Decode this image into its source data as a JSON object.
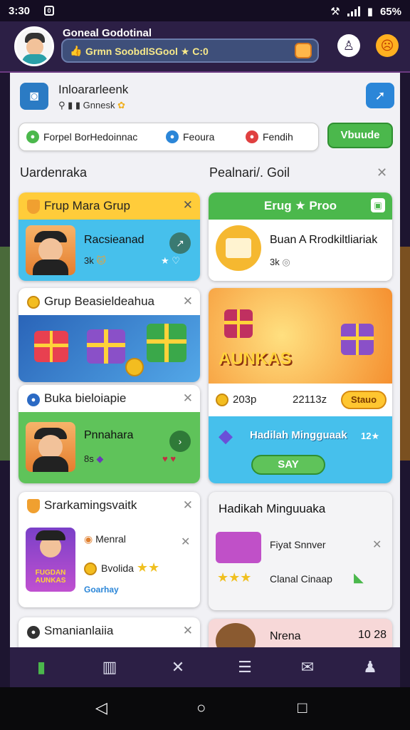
{
  "status_bar": {
    "time": "3:30",
    "notif": "0",
    "battery": "65%"
  },
  "header": {
    "title": "Goneal Godotinal",
    "search_value": "Grmn SoobdlSGool ★ C:0",
    "search_lead_icon": "thumbs-up-icon",
    "search_trail_icon": "gift-icon",
    "right_icons": [
      "user-badge-icon",
      "emoji-icon"
    ]
  },
  "profile": {
    "name": "Inloararleenk",
    "sub": "Gnnesk",
    "share_icon": "share-icon"
  },
  "filters": {
    "items": [
      "Forpel BorHedoinnac",
      "Feoura",
      "Fendih"
    ],
    "button": "Vbuude"
  },
  "sections": {
    "left": "Uardenraka",
    "right": "Pealnari/. Goil"
  },
  "cards": {
    "frup": {
      "title": "Frup Mara Grup",
      "name": "Racsieanad",
      "stat": "3k"
    },
    "grup": {
      "title": "Grup Beasieldeahua"
    },
    "buka": {
      "title": "Buka bieloiapie",
      "name": "Pnnahara",
      "stat": "8s"
    },
    "srark": {
      "title": "Srarkamingsvaitk",
      "item1": "Menral",
      "item2": "Bvolida",
      "game_title": "FUGDAN AUNKAS",
      "badge": "Goarhay"
    },
    "smana": {
      "title": "Smanianlaiia"
    },
    "erug": {
      "title": "Erug ★ Proo",
      "name": "Buan A Rrodkiltliariak",
      "stat": "3k"
    },
    "aunas": {
      "game_title": "AUNKAS",
      "coins": "203p",
      "count": "22113z",
      "button": "Stauo"
    },
    "hadiah": {
      "title": "Hadilah Mingguaak",
      "badge": "12★",
      "button": "SAY"
    },
    "hadikah": {
      "title": "Hadikah Minguuaka",
      "item1": "Fiyat Snnver",
      "item2": "Clanal Cinaap"
    },
    "nrena": {
      "title": "Nrena",
      "value": "10 28"
    }
  },
  "bottom_nav": [
    "store-icon",
    "cards-icon",
    "close-icon",
    "list-icon",
    "chat-icon",
    "profile-icon"
  ],
  "colors": {
    "accent_yellow": "#ffcc3a",
    "accent_green": "#4bb84c",
    "accent_blue": "#46c0ec",
    "header_bg": "#2c1f45"
  }
}
